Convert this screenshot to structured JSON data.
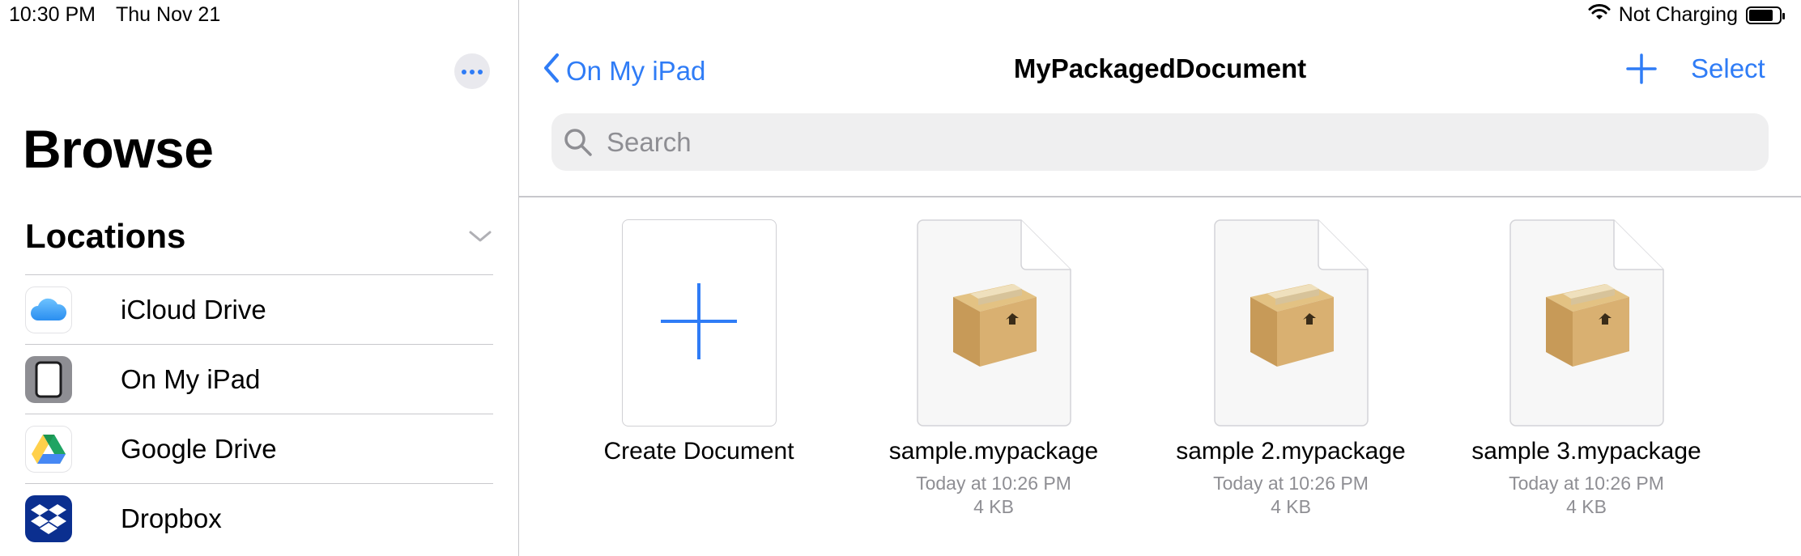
{
  "status_bar": {
    "time": "10:30 PM",
    "date": "Thu Nov 21",
    "charging": "Not Charging",
    "icons": [
      "wifi-icon",
      "battery-icon"
    ]
  },
  "sidebar": {
    "more_icon": "ellipsis-icon",
    "title": "Browse",
    "section": "Locations",
    "items": [
      {
        "label": "iCloud Drive",
        "icon": "icloud-drive-icon"
      },
      {
        "label": "On My iPad",
        "icon": "ipad-icon"
      },
      {
        "label": "Google Drive",
        "icon": "google-drive-icon"
      },
      {
        "label": "Dropbox",
        "icon": "dropbox-icon"
      }
    ]
  },
  "navbar": {
    "back_label": "On My iPad",
    "title": "MyPackagedDocument",
    "select_label": "Select",
    "accent": "#2f7cf6"
  },
  "search": {
    "placeholder": "Search"
  },
  "documents": [
    {
      "name": "Create Document"
    },
    {
      "name": "sample.mypackage",
      "date": "Today at 10:26 PM",
      "size": "4 KB"
    },
    {
      "name": "sample 2.mypackage",
      "date": "Today at 10:26 PM",
      "size": "4 KB"
    },
    {
      "name": "sample 3.mypackage",
      "date": "Today at 10:26 PM",
      "size": "4 KB"
    }
  ]
}
